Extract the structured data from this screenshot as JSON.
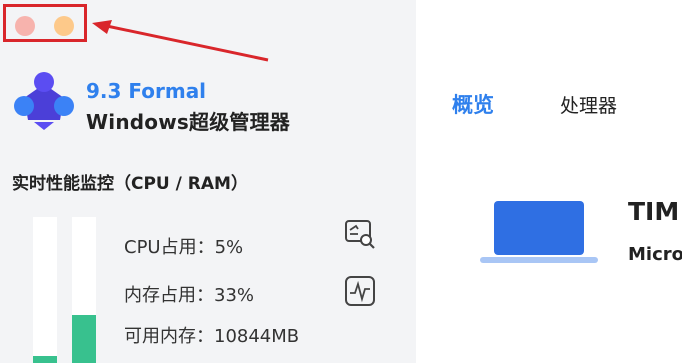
{
  "app": {
    "version": "9.3 Formal",
    "name": "Windows超级管理器"
  },
  "window_controls": {
    "close_color": "#f7b3ad",
    "minimize_color": "#fdc98a"
  },
  "annotation": {
    "color": "#d9262b"
  },
  "monitor": {
    "title": "实时性能监控（CPU / RAM）",
    "cpu_label": "CPU占用：5%",
    "mem_label": "内存占用：33%",
    "avail_label": "可用内存：10844MB",
    "cpu_percent": 5,
    "mem_percent": 33,
    "fill_color": "#38c18e"
  },
  "tabs": [
    {
      "label": "概览",
      "active": true
    },
    {
      "label": "处理器",
      "active": false
    }
  ],
  "device": {
    "title": "TIM",
    "subtitle": "Micro",
    "icon": "laptop-icon"
  },
  "icons": [
    "logo-icon",
    "inspect-icon",
    "monitor-icon",
    "laptop-icon"
  ],
  "colors": {
    "accent": "#2f80ed",
    "sidebar_bg": "#f3f4f6"
  }
}
